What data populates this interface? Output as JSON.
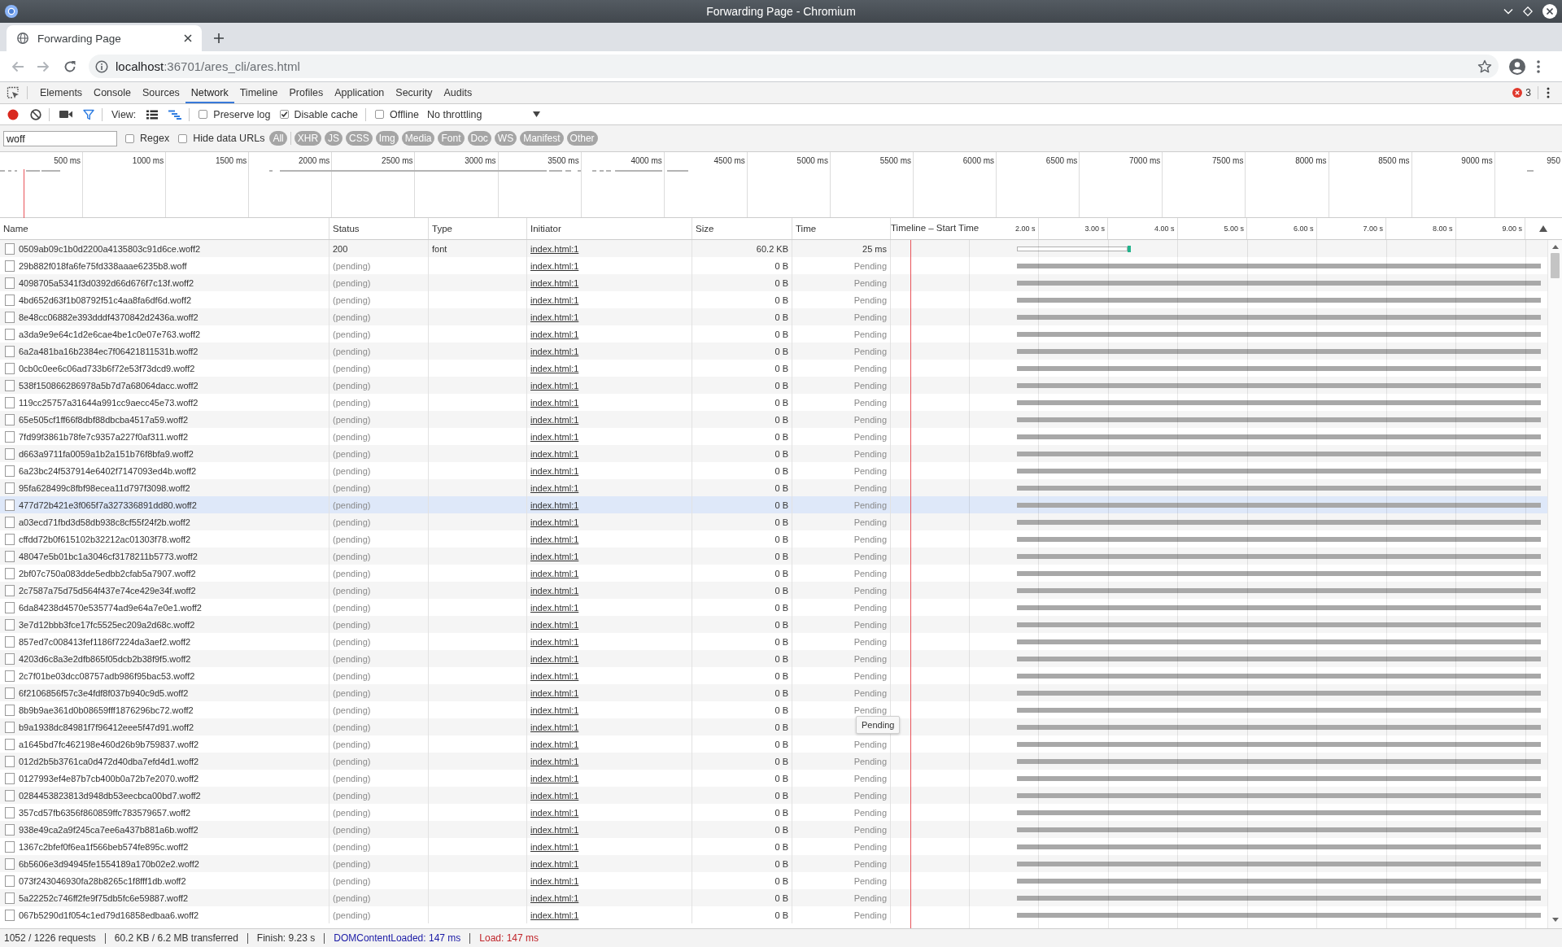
{
  "window": {
    "title": "Forwarding Page - Chromium"
  },
  "browser_tabs": [
    {
      "title": "Forwarding Page",
      "selected": true
    }
  ],
  "address_bar": {
    "host": "localhost",
    "path": ":36701/ares_cli/ares.html"
  },
  "devtools": {
    "panels": [
      {
        "label": "Elements",
        "selected": false
      },
      {
        "label": "Console",
        "selected": false
      },
      {
        "label": "Sources",
        "selected": false
      },
      {
        "label": "Network",
        "selected": true
      },
      {
        "label": "Timeline",
        "selected": false
      },
      {
        "label": "Profiles",
        "selected": false
      },
      {
        "label": "Application",
        "selected": false
      },
      {
        "label": "Security",
        "selected": false
      },
      {
        "label": "Audits",
        "selected": false
      }
    ],
    "error_count": "3"
  },
  "network_toolbar": {
    "recording": true,
    "filter_shown": true,
    "view_label": "View:",
    "large_rows": false,
    "overview_shown": true,
    "options": [
      {
        "label": "Preserve log",
        "checked": false
      },
      {
        "label": "Disable cache",
        "checked": true
      }
    ],
    "offline": {
      "label": "Offline",
      "checked": false
    },
    "throttling": "No throttling"
  },
  "filter_bar": {
    "value": "woff",
    "options": [
      {
        "label": "Regex",
        "checked": false
      },
      {
        "label": "Hide data URLs",
        "checked": false
      }
    ],
    "types": [
      "All",
      "XHR",
      "JS",
      "CSS",
      "Img",
      "Media",
      "Font",
      "Doc",
      "WS",
      "Manifest",
      "Other"
    ]
  },
  "overview": {
    "ticks": [
      "500 ms",
      "1000 ms",
      "1500 ms",
      "2000 ms",
      "2500 ms",
      "3000 ms",
      "3500 ms",
      "4000 ms",
      "4500 ms",
      "5000 ms",
      "5500 ms",
      "6000 ms",
      "6500 ms",
      "7000 ms",
      "7500 ms",
      "8000 ms",
      "8500 ms",
      "9000 ms",
      "950"
    ]
  },
  "table": {
    "columns": [
      {
        "label": "Name"
      },
      {
        "label": "Status"
      },
      {
        "label": "Type"
      },
      {
        "label": "Initiator"
      },
      {
        "label": "Size"
      },
      {
        "label": "Time"
      },
      {
        "label": "Timeline – Start Time",
        "sort_ascending": true
      }
    ],
    "timeline_ticks": [
      "2.00 s",
      "3.00 s",
      "4.00 s",
      "5.00 s",
      "6.00 s",
      "7.00 s",
      "8.00 s",
      "9.00 s"
    ],
    "rows": [
      {
        "name": "0509ab09c1b0d2200a4135803c91d6ce.woff2",
        "status": "200",
        "type": "font",
        "initiator": "index.html:1",
        "size": "60.2 KB",
        "time": "25 ms",
        "kind": "finished",
        "hovered": false
      },
      {
        "name": "29b882f018fa6fe75fd338aaae6235b8.woff",
        "status": "(pending)",
        "initiator": "index.html:1",
        "size": "0 B",
        "time": "Pending",
        "kind": "pending",
        "hovered": false
      },
      {
        "name": "4098705a5341f3d0392d66d676f7c13f.woff2",
        "status": "(pending)",
        "initiator": "index.html:1",
        "size": "0 B",
        "time": "Pending",
        "kind": "pending",
        "hovered": false
      },
      {
        "name": "4bd652d63f1b08792f51c4aa8fa6df6d.woff2",
        "status": "(pending)",
        "initiator": "index.html:1",
        "size": "0 B",
        "time": "Pending",
        "kind": "pending",
        "hovered": false
      },
      {
        "name": "8e48cc06882e393dddf4370842d2436a.woff2",
        "status": "(pending)",
        "initiator": "index.html:1",
        "size": "0 B",
        "time": "Pending",
        "kind": "pending",
        "hovered": false
      },
      {
        "name": "a3da9e9e64c1d2e6cae4be1c0e07e763.woff2",
        "status": "(pending)",
        "initiator": "index.html:1",
        "size": "0 B",
        "time": "Pending",
        "kind": "pending",
        "hovered": false
      },
      {
        "name": "6a2a481ba16b2384ec7f06421811531b.woff2",
        "status": "(pending)",
        "initiator": "index.html:1",
        "size": "0 B",
        "time": "Pending",
        "kind": "pending",
        "hovered": false
      },
      {
        "name": "0cb0c0ee6c06ad733b6f72e53f73dcd9.woff2",
        "status": "(pending)",
        "initiator": "index.html:1",
        "size": "0 B",
        "time": "Pending",
        "kind": "pending",
        "hovered": false
      },
      {
        "name": "538f150866286978a5b7d7a68064dacc.woff2",
        "status": "(pending)",
        "initiator": "index.html:1",
        "size": "0 B",
        "time": "Pending",
        "kind": "pending",
        "hovered": false
      },
      {
        "name": "119cc25757a31644a991cc9aecc45e73.woff2",
        "status": "(pending)",
        "initiator": "index.html:1",
        "size": "0 B",
        "time": "Pending",
        "kind": "pending",
        "hovered": false
      },
      {
        "name": "65e505cf1ff66f8dbf88dbcba4517a59.woff2",
        "status": "(pending)",
        "initiator": "index.html:1",
        "size": "0 B",
        "time": "Pending",
        "kind": "pending",
        "hovered": false
      },
      {
        "name": "7fd99f3861b78fe7c9357a227f0af311.woff2",
        "status": "(pending)",
        "initiator": "index.html:1",
        "size": "0 B",
        "time": "Pending",
        "kind": "pending",
        "hovered": false
      },
      {
        "name": "d663a9711fa0059a1b2a151b76f8bfa9.woff2",
        "status": "(pending)",
        "initiator": "index.html:1",
        "size": "0 B",
        "time": "Pending",
        "kind": "pending",
        "hovered": false
      },
      {
        "name": "6a23bc24f537914e6402f7147093ed4b.woff2",
        "status": "(pending)",
        "initiator": "index.html:1",
        "size": "0 B",
        "time": "Pending",
        "kind": "pending",
        "hovered": false
      },
      {
        "name": "95fa628499c8fbf98ecea11d797f3098.woff2",
        "status": "(pending)",
        "initiator": "index.html:1",
        "size": "0 B",
        "time": "Pending",
        "kind": "pending",
        "hovered": false
      },
      {
        "name": "477d72b421e3f065f7a327336891dd80.woff2",
        "status": "(pending)",
        "initiator": "index.html:1",
        "size": "0 B",
        "time": "Pending",
        "kind": "pending",
        "hovered": true
      },
      {
        "name": "a03ecd71fbd3d58db938c8cf55f24f2b.woff2",
        "status": "(pending)",
        "initiator": "index.html:1",
        "size": "0 B",
        "time": "Pending",
        "kind": "pending",
        "hovered": false
      },
      {
        "name": "cffdd72b0f615102b32212ac01303f78.woff2",
        "status": "(pending)",
        "initiator": "index.html:1",
        "size": "0 B",
        "time": "Pending",
        "kind": "pending",
        "hovered": false
      },
      {
        "name": "48047e5b01bc1a3046cf3178211b5773.woff2",
        "status": "(pending)",
        "initiator": "index.html:1",
        "size": "0 B",
        "time": "Pending",
        "kind": "pending",
        "hovered": false
      },
      {
        "name": "2bf07c750a083dde5edbb2cfab5a7907.woff2",
        "status": "(pending)",
        "initiator": "index.html:1",
        "size": "0 B",
        "time": "Pending",
        "kind": "pending",
        "hovered": false
      },
      {
        "name": "2c7587a75d75d564f437e74ce429e34f.woff2",
        "status": "(pending)",
        "initiator": "index.html:1",
        "size": "0 B",
        "time": "Pending",
        "kind": "pending",
        "hovered": false
      },
      {
        "name": "6da84238d4570e535774ad9e64a7e0e1.woff2",
        "status": "(pending)",
        "initiator": "index.html:1",
        "size": "0 B",
        "time": "Pending",
        "kind": "pending",
        "hovered": false
      },
      {
        "name": "3e7d12bbb3fce17fc5525ec209a2d68c.woff2",
        "status": "(pending)",
        "initiator": "index.html:1",
        "size": "0 B",
        "time": "Pending",
        "kind": "pending",
        "hovered": false
      },
      {
        "name": "857ed7c008413fef1186f7224da3aef2.woff2",
        "status": "(pending)",
        "initiator": "index.html:1",
        "size": "0 B",
        "time": "Pending",
        "kind": "pending",
        "hovered": false
      },
      {
        "name": "4203d6c8a3e2dfb865f05dcb2b38f9f5.woff2",
        "status": "(pending)",
        "initiator": "index.html:1",
        "size": "0 B",
        "time": "Pending",
        "kind": "pending",
        "hovered": false
      },
      {
        "name": "2c7f01be03dcc08757adb986f95bac53.woff2",
        "status": "(pending)",
        "initiator": "index.html:1",
        "size": "0 B",
        "time": "Pending",
        "kind": "pending",
        "hovered": false
      },
      {
        "name": "6f2106856f57c3e4fdf8f037b940c9d5.woff2",
        "status": "(pending)",
        "initiator": "index.html:1",
        "size": "0 B",
        "time": "Pending",
        "kind": "pending",
        "hovered": false
      },
      {
        "name": "8b9b9ae361d0b08659fff1876296bc72.woff2",
        "status": "(pending)",
        "initiator": "index.html:1",
        "size": "0 B",
        "time": "Pending",
        "kind": "pending",
        "hovered": false
      },
      {
        "name": "b9a1938dc84981f7f96412eee5f47d91.woff2",
        "status": "(pending)",
        "initiator": "index.html:1",
        "size": "0 B",
        "kind": "pending",
        "hovered": false
      },
      {
        "name": "a1645bd7fc462198e460d26b9b759837.woff2",
        "status": "(pending)",
        "initiator": "index.html:1",
        "size": "0 B",
        "time": "Pending",
        "kind": "pending",
        "hovered": false
      },
      {
        "name": "012d2b5b3761ca0d472d40dba7efd4d1.woff2",
        "status": "(pending)",
        "initiator": "index.html:1",
        "size": "0 B",
        "time": "Pending",
        "kind": "pending",
        "hovered": false
      },
      {
        "name": "0127993ef4e87b7cb400b0a72b7e2070.woff2",
        "status": "(pending)",
        "initiator": "index.html:1",
        "size": "0 B",
        "time": "Pending",
        "kind": "pending",
        "hovered": false
      },
      {
        "name": "0284453823813d948db53eecbca00bd7.woff2",
        "status": "(pending)",
        "initiator": "index.html:1",
        "size": "0 B",
        "time": "Pending",
        "kind": "pending",
        "hovered": false
      },
      {
        "name": "357cd57fb6356f860859ffc783579657.woff2",
        "status": "(pending)",
        "initiator": "index.html:1",
        "size": "0 B",
        "time": "Pending",
        "kind": "pending",
        "hovered": false
      },
      {
        "name": "938e49ca2a9f245ca7ee6a437b881a6b.woff2",
        "status": "(pending)",
        "initiator": "index.html:1",
        "size": "0 B",
        "time": "Pending",
        "kind": "pending",
        "hovered": false
      },
      {
        "name": "1367c2bfef0f6ea1f566beb574fe895c.woff2",
        "status": "(pending)",
        "initiator": "index.html:1",
        "size": "0 B",
        "time": "Pending",
        "kind": "pending",
        "hovered": false
      },
      {
        "name": "6b5606e3d94945fe1554189a170b02e2.woff2",
        "status": "(pending)",
        "initiator": "index.html:1",
        "size": "0 B",
        "time": "Pending",
        "kind": "pending",
        "hovered": false
      },
      {
        "name": "073f243046930fa28b8265c1f8fff1db.woff2",
        "status": "(pending)",
        "initiator": "index.html:1",
        "size": "0 B",
        "time": "Pending",
        "kind": "pending",
        "hovered": false
      },
      {
        "name": "5a22252c746ff2fe9f75db5fc6e59887.woff2",
        "status": "(pending)",
        "initiator": "index.html:1",
        "size": "0 B",
        "time": "Pending",
        "kind": "pending",
        "hovered": false
      },
      {
        "name": "067b5290d1f054c1ed79d16858edbaa6.woff2",
        "status": "(pending)",
        "initiator": "index.html:1",
        "size": "0 B",
        "time": "Pending",
        "kind": "pending",
        "hovered": false
      }
    ]
  },
  "tooltip": {
    "text": "Pending"
  },
  "summary": [
    {
      "text": "1052 / 1226 requests",
      "kind": "plain"
    },
    {
      "text": "60.2 KB / 6.2 MB transferred",
      "kind": "plain"
    },
    {
      "text": "Finish: 9.23 s",
      "kind": "plain"
    },
    {
      "text": "DOMContentLoaded: 147 ms",
      "kind": "dom"
    },
    {
      "text": "Load: 147 ms",
      "kind": "load"
    }
  ]
}
